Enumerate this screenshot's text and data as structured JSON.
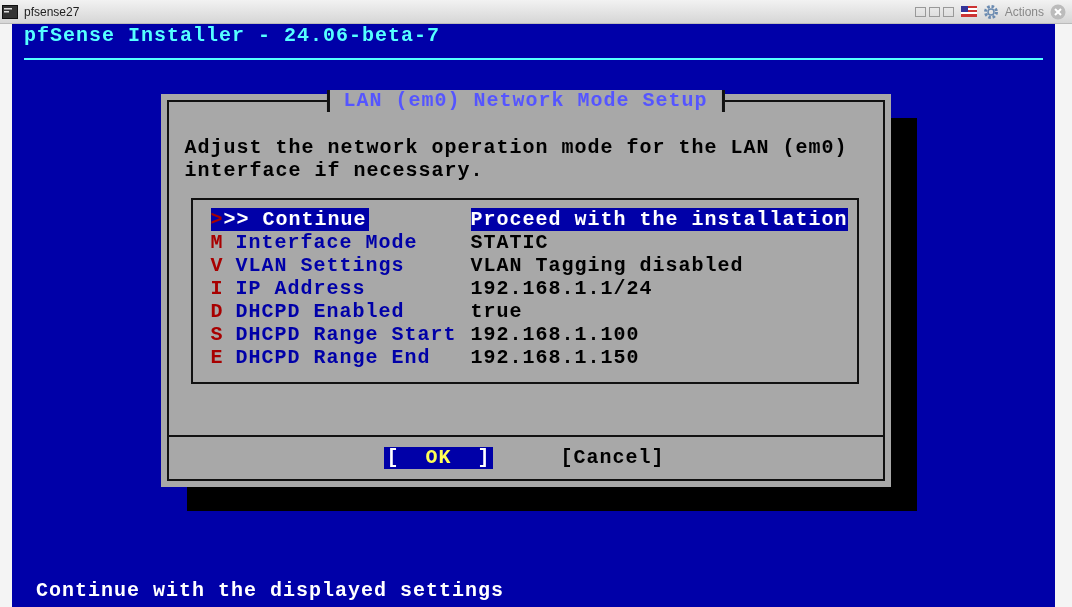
{
  "window": {
    "title": "pfsense27",
    "actions_label": "Actions"
  },
  "console": {
    "header": "pfSense Installer - 24.06-beta-7",
    "status_line": "Continue with the displayed settings"
  },
  "dialog": {
    "title": "LAN (em0) Network Mode Setup",
    "message": "Adjust the network operation mode for the LAN (em0) interface if necessary.",
    "items": [
      {
        "key": ">",
        "name": ">> Continue",
        "description": "Proceed with the installation",
        "selected": true
      },
      {
        "key": "M",
        "name": "Interface Mode",
        "description": "STATIC",
        "selected": false
      },
      {
        "key": "V",
        "name": "VLAN Settings",
        "description": "VLAN Tagging disabled",
        "selected": false
      },
      {
        "key": "I",
        "name": "IP Address",
        "description": "192.168.1.1/24",
        "selected": false
      },
      {
        "key": "D",
        "name": "DHCPD Enabled",
        "description": "true",
        "selected": false
      },
      {
        "key": "S",
        "name": "DHCPD Range Start",
        "description": "192.168.1.100",
        "selected": false
      },
      {
        "key": "E",
        "name": "DHCPD Range End",
        "description": "192.168.1.150",
        "selected": false
      }
    ],
    "buttons": [
      {
        "open": "[",
        "label": "OK",
        "close": "]",
        "selected": true
      },
      {
        "open": "[",
        "label": "Cancel",
        "close": "]",
        "selected": false
      }
    ]
  }
}
